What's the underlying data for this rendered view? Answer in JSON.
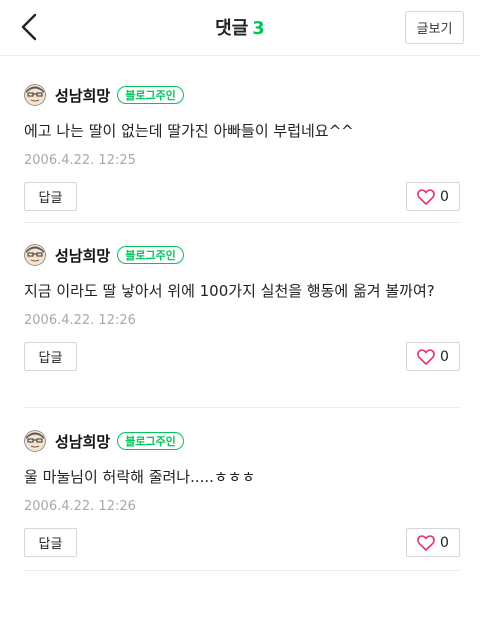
{
  "header": {
    "title": "댓글",
    "count": "3",
    "view_post_label": "글보기"
  },
  "colors": {
    "accent": "#03c75a",
    "heart": "#e7306c",
    "date": "#a8a8a8"
  },
  "comments": [
    {
      "nickname": "성남희망",
      "badge": "블로그주인",
      "text": "에고 나는 딸이 없는데 딸가진 아빠들이 부럽네요^^",
      "date": "2006.4.22. 12:25",
      "reply_label": "답글",
      "likes": "0"
    },
    {
      "nickname": "성남희망",
      "badge": "블로그주인",
      "text": "지금 이라도 딸 낳아서 위에 100가지 실천을 행동에 옮겨 볼까여?",
      "date": "2006.4.22. 12:26",
      "reply_label": "답글",
      "likes": "0"
    },
    {
      "nickname": "성남희망",
      "badge": "블로그주인",
      "text": "울 마눌님이 허락해 줄려나.....ㅎㅎㅎ",
      "date": "2006.4.22. 12:26",
      "reply_label": "답글",
      "likes": "0"
    }
  ]
}
